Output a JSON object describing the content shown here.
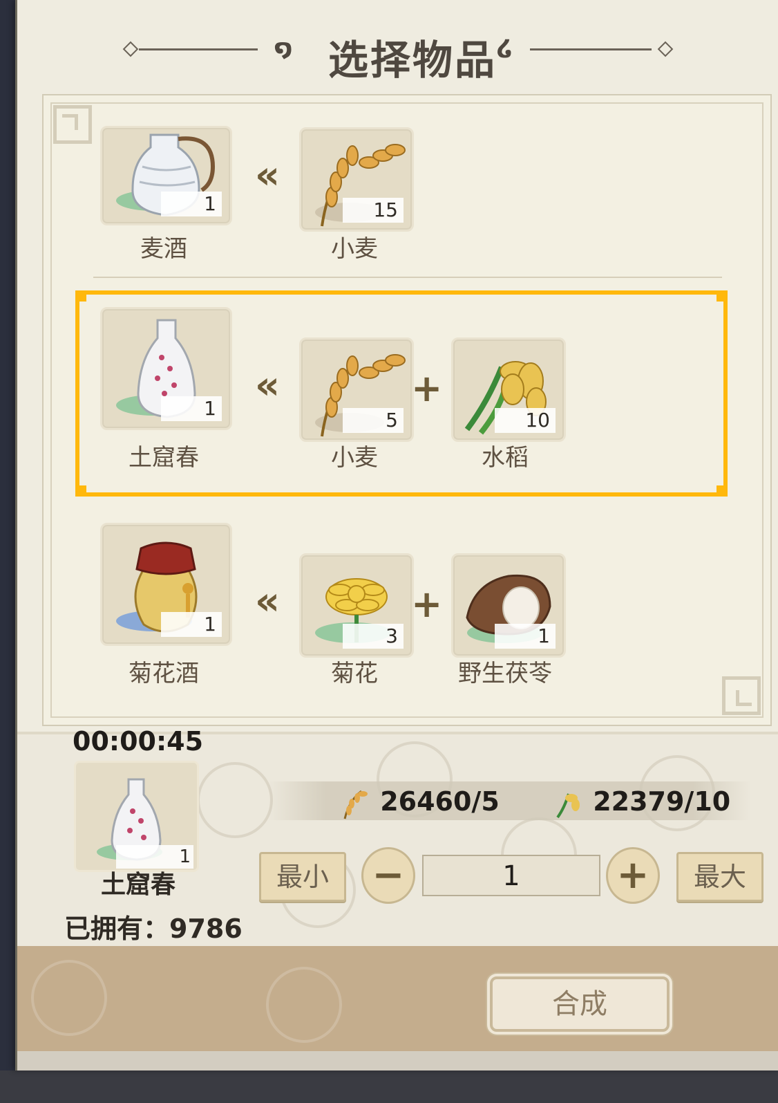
{
  "header": {
    "title": "选择物品"
  },
  "recipes": [
    {
      "product": {
        "name": "麦酒",
        "count": "1"
      },
      "ingredients": [
        {
          "name": "小麦",
          "count": "15"
        }
      ]
    },
    {
      "product": {
        "name": "土窟春",
        "count": "1"
      },
      "ingredients": [
        {
          "name": "小麦",
          "count": "5"
        },
        {
          "name": "水稻",
          "count": "10"
        }
      ],
      "selected": true
    },
    {
      "product": {
        "name": "菊花酒",
        "count": "1"
      },
      "ingredients": [
        {
          "name": "菊花",
          "count": "3"
        },
        {
          "name": "野生茯苓",
          "count": "1"
        }
      ]
    }
  ],
  "production": {
    "timer": "00:00:45",
    "product_name": "土窟春",
    "product_count": "1",
    "owned_label": "已拥有：9786",
    "resources": [
      {
        "icon": "wheat-icon",
        "text": "26460/5"
      },
      {
        "icon": "rice-icon",
        "text": "22379/10"
      }
    ],
    "min_label": "最小",
    "max_label": "最大",
    "quantity": "1",
    "synth_label": "合成"
  },
  "colors": {
    "selected_border": "#ffb80c",
    "panel_bg": "#efece0",
    "footer_bg": "#c4ad8d"
  }
}
